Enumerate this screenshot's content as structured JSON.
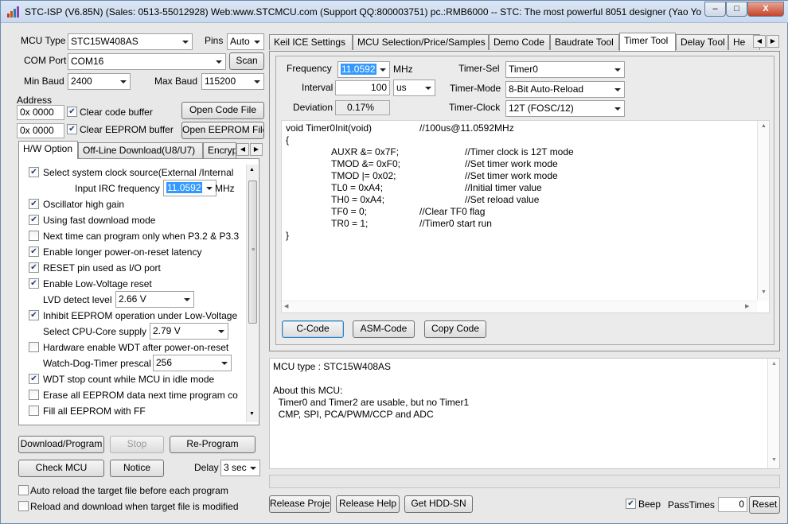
{
  "title": "STC-ISP (V6.85N) (Sales: 0513-55012928) Web:www.STCMCU.com  (Support QQ:800003751)  pc.:RMB6000 -- STC: The most powerful 8051 designer (Yao Yon...",
  "window_controls": {
    "minimize": "–",
    "maximize": "□",
    "close": "X"
  },
  "left": {
    "mcu_type_label": "MCU Type",
    "mcu_type_value": "STC15W408AS",
    "pins_label": "Pins",
    "pins_value": "Auto",
    "com_port_label": "COM Port",
    "com_port_value": "COM16",
    "scan_button": "Scan",
    "min_baud_label": "Min Baud",
    "min_baud_value": "2400",
    "max_baud_label": "Max Baud",
    "max_baud_value": "115200",
    "address_label": "Address",
    "address1_value": "0x 0000",
    "clear_code_buffer": "Clear code buffer",
    "open_code_file": "Open Code File",
    "address2_value": "0x 0000",
    "clear_eeprom_buffer": "Clear EEPROM buffer",
    "open_eeprom_file": "Open EEPROM File",
    "tabs": [
      "H/W Option",
      "Off-Line Download(U8/U7)",
      "Encryp"
    ],
    "hw_options": [
      {
        "type": "check",
        "checked": true,
        "label": "Select system clock source(External /Internal"
      },
      {
        "type": "field",
        "label": "Input IRC frequency",
        "value": "11.0592",
        "suffix": "MHz"
      },
      {
        "type": "check",
        "checked": true,
        "label": "Oscillator high gain"
      },
      {
        "type": "check",
        "checked": true,
        "label": "Using fast download mode"
      },
      {
        "type": "check",
        "checked": false,
        "label": "Next time can program only when P3.2 & P3.3"
      },
      {
        "type": "check",
        "checked": true,
        "label": "Enable longer power-on-reset latency"
      },
      {
        "type": "check",
        "checked": true,
        "label": "RESET pin used as I/O port"
      },
      {
        "type": "check",
        "checked": true,
        "label": "Enable Low-Voltage reset"
      },
      {
        "type": "field",
        "label": "LVD detect level",
        "value": "2.66 V"
      },
      {
        "type": "check",
        "checked": true,
        "label": "Inhibit EEPROM operation under Low-Voltage"
      },
      {
        "type": "field",
        "label": "Select CPU-Core supply level",
        "value": "2.79 V"
      },
      {
        "type": "check",
        "checked": false,
        "label": "Hardware enable WDT after power-on-reset"
      },
      {
        "type": "field",
        "label": "Watch-Dog-Timer prescal",
        "value": "256"
      },
      {
        "type": "check",
        "checked": true,
        "label": "WDT stop count while MCU in idle mode"
      },
      {
        "type": "check",
        "checked": false,
        "label": "Erase all EEPROM data next time program co"
      },
      {
        "type": "check",
        "checked": false,
        "label": "Fill all EEPROM with FF"
      }
    ],
    "download_program": "Download/Program",
    "stop": "Stop",
    "re_program": "Re-Program",
    "check_mcu": "Check MCU",
    "notice": "Notice",
    "delay_label": "Delay",
    "delay_value": "3 sec",
    "auto_reload": "Auto reload the target file before each program",
    "reload_download": "Reload and download when target file is modified"
  },
  "right": {
    "tabs": [
      "Keil ICE Settings",
      "MCU Selection/Price/Samples",
      "Demo Code",
      "Baudrate Tool",
      "Timer Tool",
      "Delay Tool",
      "He"
    ],
    "active_tab": "Timer Tool",
    "frequency_label": "Frequency",
    "frequency_value": "11.0592",
    "frequency_unit": "MHz",
    "interval_label": "Interval",
    "interval_value": "100",
    "interval_unit": "us",
    "deviation_label": "Deviation",
    "deviation_value": "0.17%",
    "timer_sel_label": "Timer-Sel",
    "timer_sel_value": "Timer0",
    "timer_mode_label": "Timer-Mode",
    "timer_mode_value": "8-Bit Auto-Reload",
    "timer_clock_label": "Timer-Clock",
    "timer_clock_value": "12T (FOSC/12)",
    "code_lines": [
      {
        "code": "void Timer0Init(void)",
        "comment": "//100us@11.0592MHz"
      },
      {
        "code": "{",
        "comment": ""
      },
      {
        "code": "AUXR &= 0x7F;",
        "comment": "//Timer clock is 12T mode"
      },
      {
        "code": "TMOD &= 0xF0;",
        "comment": "//Set timer work mode"
      },
      {
        "code": "TMOD |= 0x02;",
        "comment": "//Set timer work mode"
      },
      {
        "code": "TL0 = 0xA4;",
        "comment": "//Initial timer value"
      },
      {
        "code": "TH0 = 0xA4;",
        "comment": "//Set reload value"
      },
      {
        "code": "TF0 = 0;",
        "comment": "//Clear TF0 flag"
      },
      {
        "code": "TR0 = 1;",
        "comment": "//Timer0 start run"
      },
      {
        "code": "}",
        "comment": ""
      }
    ],
    "c_code_button": "C-Code",
    "asm_code_button": "ASM-Code",
    "copy_code_button": "Copy Code",
    "info_lines": [
      "MCU type : STC15W408AS",
      "",
      "About this MCU:",
      "  Timer0 and Timer2 are usable, but no Timer1",
      "  CMP, SPI, PCA/PWM/CCP and ADC"
    ],
    "release_project": "Release Project",
    "release_help": "Release Help",
    "get_hdd_sn": "Get HDD-SN",
    "beep_label": "Beep",
    "pass_times_label": "PassTimes",
    "pass_times_value": "0",
    "reset_button": "Reset"
  }
}
